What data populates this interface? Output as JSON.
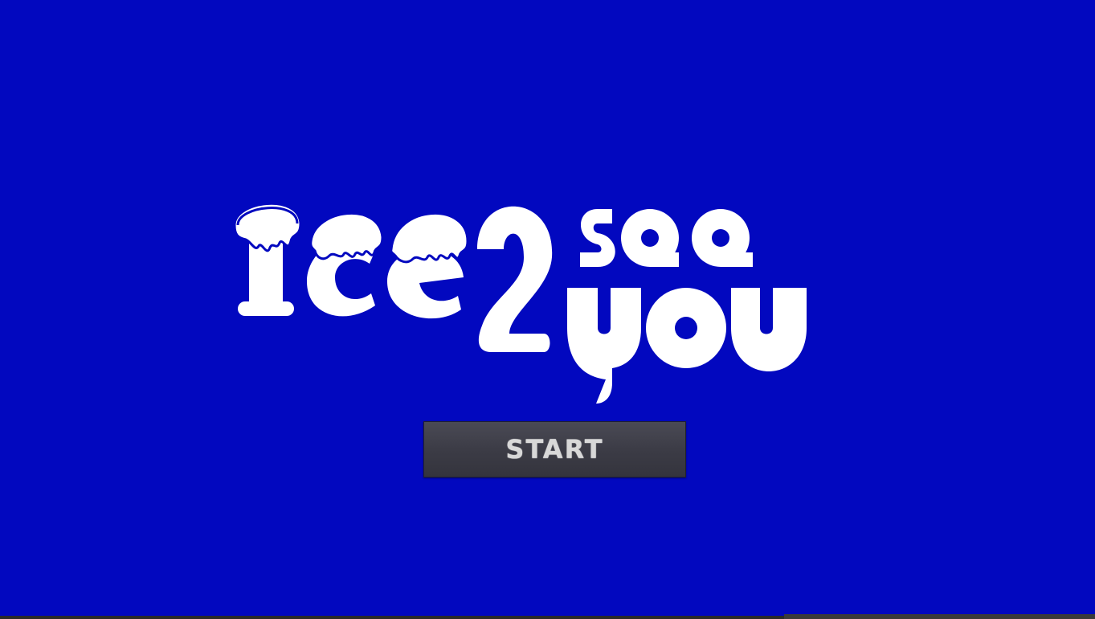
{
  "game": {
    "title_line_1": "ice2",
    "title_line_2": "see",
    "title_line_3": "you",
    "start_label": "START"
  },
  "colors": {
    "background": "#0208BF",
    "logo": "#FFFFFF",
    "button_bg": "#3C3C46",
    "button_text": "#D8D8D8"
  }
}
